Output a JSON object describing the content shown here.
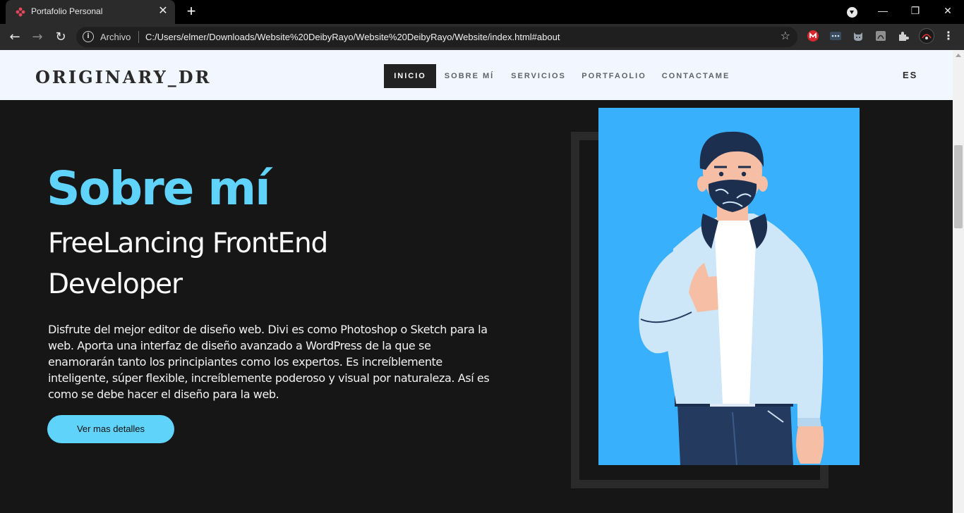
{
  "tab": {
    "title": "Portafolio Personal",
    "close": "✕",
    "new_tab": "+"
  },
  "window": {
    "minimize": "—",
    "restore": "❐",
    "close": "✕"
  },
  "toolbar": {
    "back": "←",
    "forward": "→",
    "reload": "↻",
    "info": "i",
    "scheme": "Archivo",
    "url": "C:/Users/elmer/Downloads/Website%20DeibyRayo/Website%20DeibyRayo/Website/index.html#about",
    "star": "☆",
    "menu": "⋮"
  },
  "site": {
    "logo": "ORIGINARY_DR",
    "nav": [
      "INICIO",
      "SOBRE MÍ",
      "SERVICIOS",
      "PORTFAOLIO",
      "CONTACTAME"
    ],
    "lang": "ES"
  },
  "hero": {
    "title": "Sobre mí",
    "subtitle": "FreeLancing FrontEnd Developer",
    "body": "Disfrute del mejor editor de diseño web. Divi es como Photoshop o Sketch para la web. Aporta una interfaz de diseño avanzado a WordPress de la que se enamorarán tanto los principiantes como los expertos. Es increíblemente inteligente, súper flexible, increíblemente poderoso y visual por naturaleza. Así es como se debe hacer el diseño para la web.",
    "cta": "Ver mas detalles"
  },
  "colors": {
    "accent": "#5fd3fa",
    "page_bg": "#161616",
    "header_bg": "#f2f6fe",
    "portrait_bg": "#39b0fb"
  }
}
